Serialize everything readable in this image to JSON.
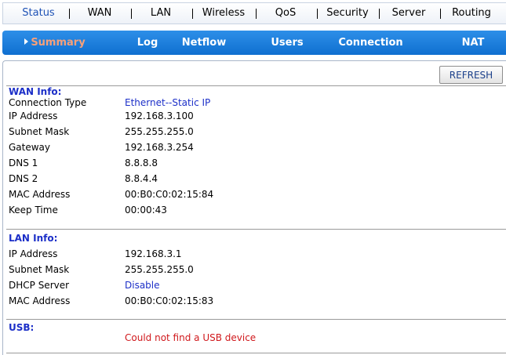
{
  "topnav": {
    "items": [
      {
        "label": "Status",
        "active": true
      },
      {
        "label": "WAN"
      },
      {
        "label": "LAN"
      },
      {
        "label": "Wireless"
      },
      {
        "label": "QoS"
      },
      {
        "label": "Security"
      },
      {
        "label": "Server"
      },
      {
        "label": "Routing"
      }
    ]
  },
  "subnav": {
    "items": [
      {
        "label": "Summary",
        "active": true
      },
      {
        "label": "Log"
      },
      {
        "label": "Netflow"
      },
      {
        "label": "Users"
      },
      {
        "label": "Connection"
      },
      {
        "label": "NAT"
      }
    ]
  },
  "refresh_label": "REFRESH",
  "wan": {
    "title": "WAN Info:",
    "rows": [
      {
        "label": "Connection Type",
        "value": "Ethernet--Static IP"
      },
      {
        "label": "IP Address",
        "value": "192.168.3.100"
      },
      {
        "label": "Subnet Mask",
        "value": "255.255.255.0"
      },
      {
        "label": "Gateway",
        "value": "192.168.3.254"
      },
      {
        "label": "DNS 1",
        "value": "8.8.8.8"
      },
      {
        "label": "DNS 2",
        "value": "8.8.4.4"
      },
      {
        "label": "MAC Address",
        "value": "00:B0:C0:02:15:84"
      },
      {
        "label": "Keep Time",
        "value": "00:00:43"
      }
    ]
  },
  "lan": {
    "title": "LAN Info:",
    "rows": [
      {
        "label": "IP Address",
        "value": "192.168.3.1"
      },
      {
        "label": "Subnet Mask",
        "value": "255.255.255.0"
      },
      {
        "label": "DHCP Server",
        "value": "Disable"
      },
      {
        "label": "MAC Address",
        "value": "00:B0:C0:02:15:83"
      }
    ]
  },
  "usb": {
    "title": "USB:",
    "message": "Could not find a USB device"
  },
  "colors": {
    "accent_blue": "#1c2fc8",
    "active_nav": "#1f53b6",
    "subnav_bg": "#1a7ee0",
    "subnav_active": "#f7a07a",
    "error_red": "#d0181c"
  }
}
